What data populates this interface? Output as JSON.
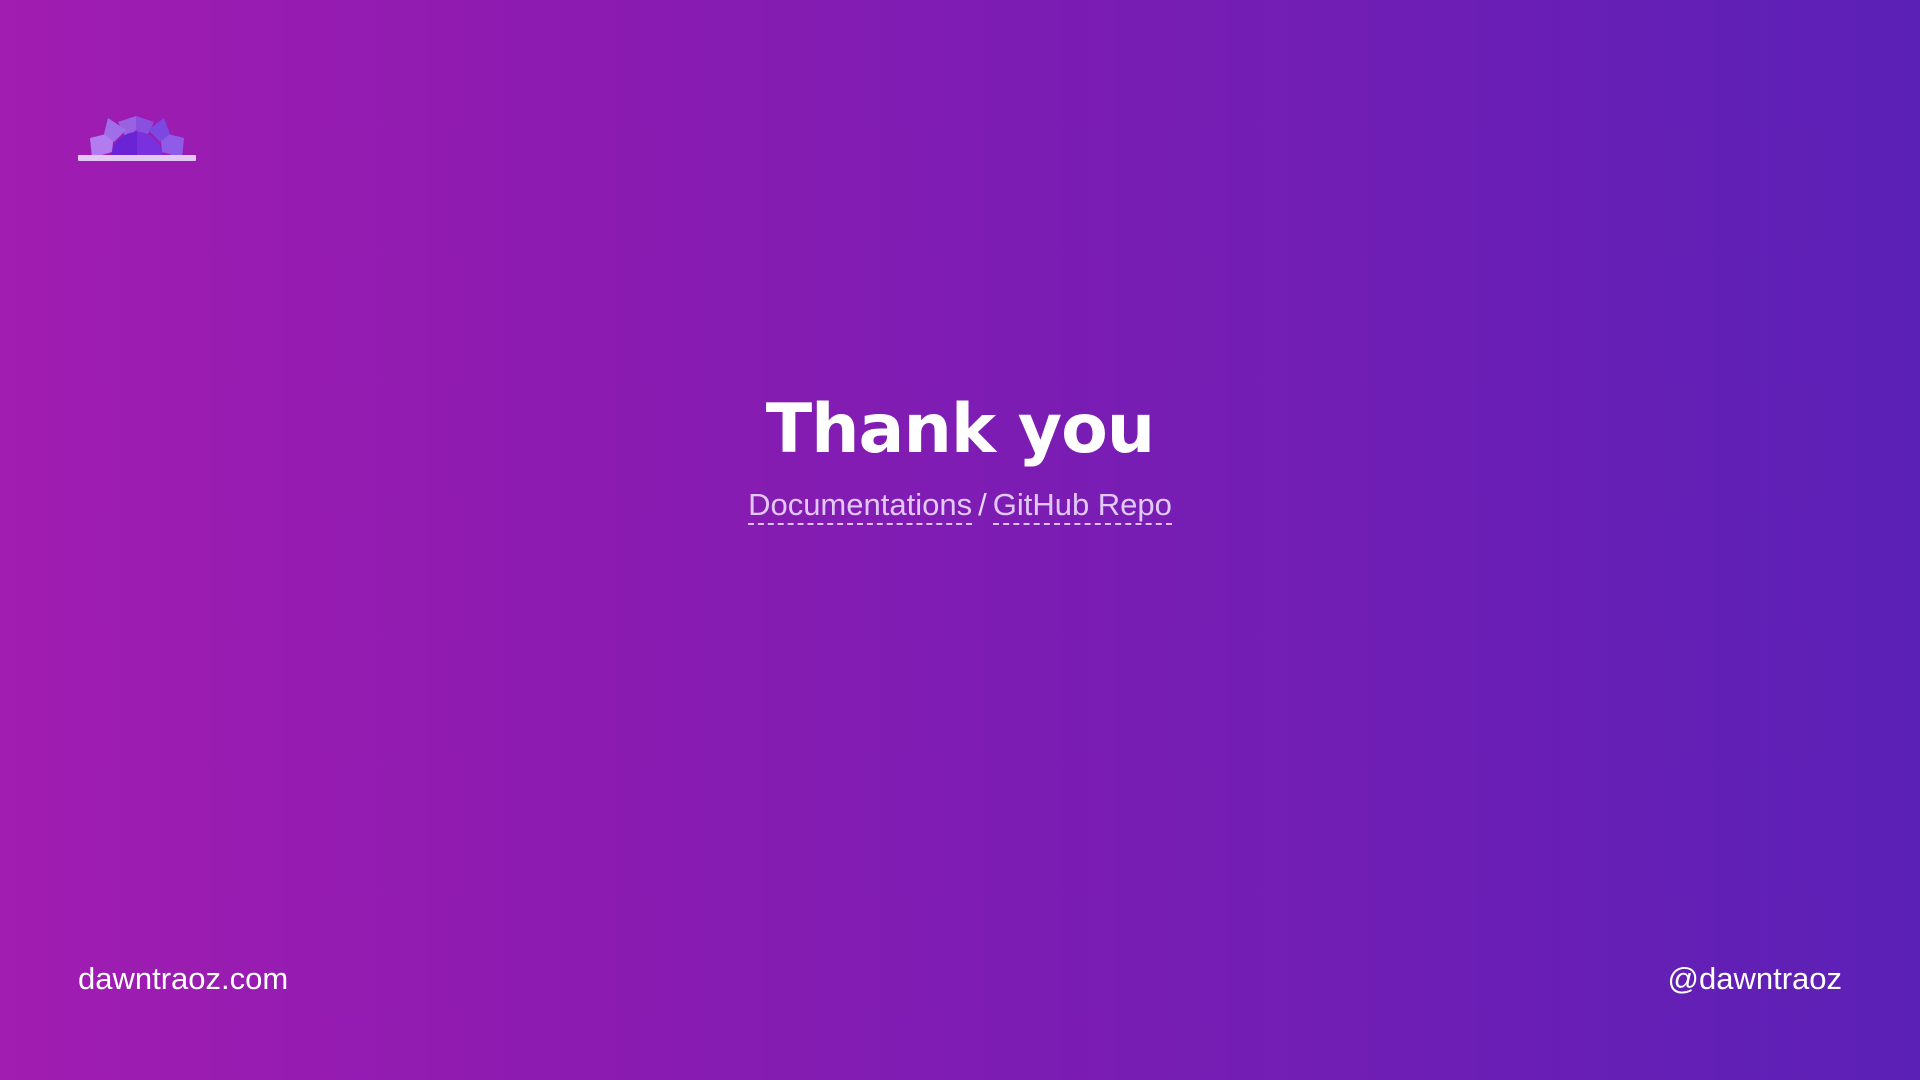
{
  "slide": {
    "title": "Thank you",
    "links": {
      "documentation_label": "Documentations",
      "separator": "/",
      "github_label": "GitHub Repo"
    },
    "footer": {
      "website": "dawntraoz.com",
      "handle": "@dawntraoz"
    },
    "logo_icon": "sunrise-logo-icon",
    "colors": {
      "gradient_start": "#a11cb1",
      "gradient_end": "#5b20b6",
      "link_color": "#e2c8f6",
      "logo_light": "#a374ec",
      "logo_dark": "#6a24d6",
      "logo_base": "#e3c8f5"
    }
  }
}
